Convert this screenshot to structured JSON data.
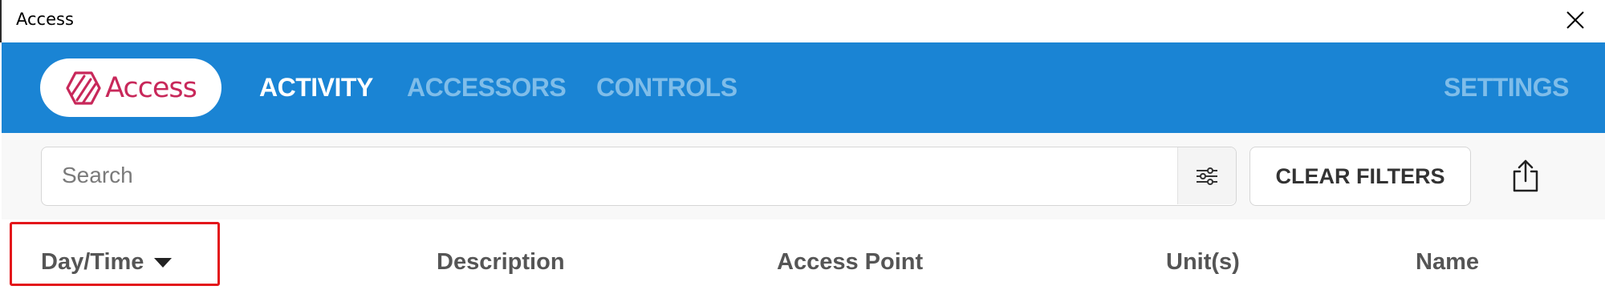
{
  "window": {
    "title": "Access",
    "close_icon": "close-icon"
  },
  "nav": {
    "logo_text": "Access",
    "logo_icon": "access-hexagon-logo-icon",
    "brand_color": "#c8285a",
    "bar_color": "#1a84d4",
    "tabs": [
      {
        "label": "ACTIVITY",
        "active": true
      },
      {
        "label": "ACCESSORS",
        "active": false
      },
      {
        "label": "CONTROLS",
        "active": false
      }
    ],
    "settings_label": "SETTINGS"
  },
  "toolbar": {
    "search_placeholder": "Search",
    "search_value": "",
    "filter_icon": "filter-sliders-icon",
    "clear_filters_label": "CLEAR FILTERS",
    "export_icon": "share-export-icon"
  },
  "table": {
    "columns": [
      {
        "label": "Day/Time",
        "sorted": "descending",
        "sort_icon": "caret-down-icon"
      },
      {
        "label": "Description"
      },
      {
        "label": "Access Point"
      },
      {
        "label": "Unit(s)"
      },
      {
        "label": "Name"
      }
    ],
    "highlight_color": "#e3161b"
  }
}
